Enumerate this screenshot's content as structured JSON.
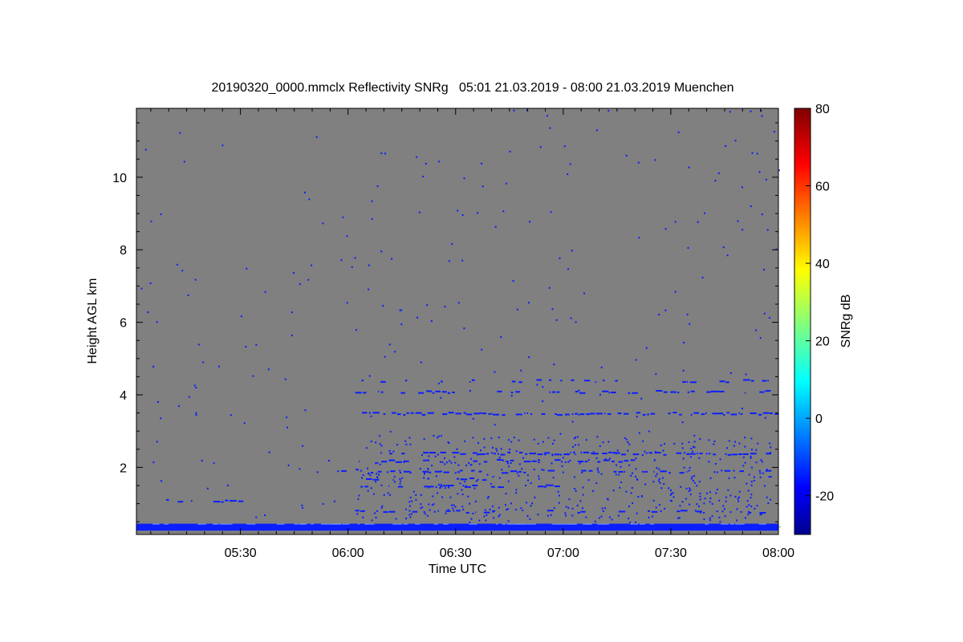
{
  "chart_data": {
    "type": "heatmap",
    "title": "20190320_0000.mmclx Reflectivity SNRg   05:01 21.03.2019 - 08:00 21.03.2019 Muenchen",
    "xlabel": "Time UTC",
    "ylabel": "Height AGL km",
    "x_ticks": [
      "05:30",
      "06:00",
      "06:30",
      "07:00",
      "07:30",
      "08:00"
    ],
    "x_tick_values_min": [
      330,
      360,
      390,
      420,
      450,
      480
    ],
    "xlim_min": [
      301,
      480
    ],
    "y_ticks": [
      "2",
      "4",
      "6",
      "8",
      "10"
    ],
    "y_tick_values": [
      2,
      4,
      6,
      8,
      10
    ],
    "ylim": [
      0.15,
      11.9
    ],
    "colorbar": {
      "label": "SNRg dB",
      "ticks": [
        "-20",
        "0",
        "20",
        "40",
        "60",
        "80"
      ],
      "tick_values": [
        -20,
        0,
        20,
        40,
        60,
        80
      ],
      "range": [
        -30,
        80
      ],
      "colormap": "jet"
    },
    "background_color": "#808080",
    "echo_color": "#0a1eff",
    "layers": [
      {
        "height_km": 0.3,
        "start_min": 301,
        "end_min": 480,
        "density": "continuous"
      },
      {
        "height_km": 0.38,
        "start_min": 301,
        "end_min": 480,
        "density": "continuous"
      },
      {
        "height_km": 4.4,
        "start_min": 360,
        "end_min": 478,
        "density": "sparse"
      },
      {
        "height_km": 4.1,
        "start_min": 362,
        "end_min": 478,
        "density": "medium"
      },
      {
        "height_km": 3.5,
        "start_min": 362,
        "end_min": 480,
        "density": "dense"
      },
      {
        "height_km": 2.4,
        "start_min": 367,
        "end_min": 478,
        "density": "dense"
      },
      {
        "height_km": 2.2,
        "start_min": 363,
        "end_min": 440,
        "density": "medium"
      },
      {
        "height_km": 1.9,
        "start_min": 357,
        "end_min": 480,
        "density": "medium"
      },
      {
        "height_km": 1.7,
        "start_min": 365,
        "end_min": 400,
        "density": "sparse"
      },
      {
        "height_km": 1.5,
        "start_min": 363,
        "end_min": 420,
        "density": "medium"
      },
      {
        "height_km": 0.8,
        "start_min": 362,
        "end_min": 478,
        "density": "sparse"
      },
      {
        "height_km": 1.1,
        "start_min": 306,
        "end_min": 333,
        "density": "sparse"
      }
    ]
  }
}
